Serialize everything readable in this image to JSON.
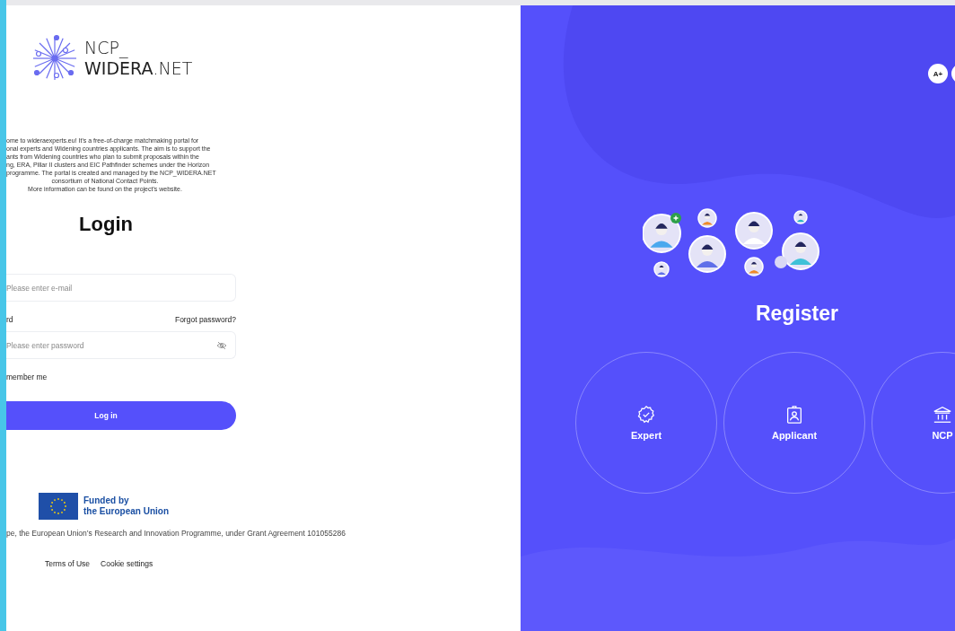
{
  "logo": {
    "line1": "NCP_",
    "line2": "**WIDERA**.NET"
  },
  "intro_lines": [
    "ome to wideraexperts.eu! It's a free-of-charge matchmaking portal for",
    "onal experts and Widening countries applicants. The aim is to support the",
    "ants from Widening countries who plan to submit proposals within the",
    "ng, ERA, Pillar II clusters and EIC Pathfinder schemes under the Horizon",
    "programme. The portal is created and managed by the NCP_WIDERA.NET",
    "consortium of National Contact Points.",
    "More information can be found on the project's website."
  ],
  "login": {
    "title": "Login",
    "email": {
      "placeholder": "Please enter e-mail"
    },
    "password_label": "rd",
    "forgot": "Forgot password?",
    "password": {
      "placeholder": "Please enter password"
    },
    "remember_label": "member me",
    "submit": "Log in"
  },
  "funding": {
    "label": "Funded by\nthe European Union"
  },
  "grant_text": "pe, the European Union’s Research and Innovation Programme, under Grant Agreement 101055286",
  "footer_links": [
    "Terms of Use",
    "Cookie settings"
  ],
  "font_size_button": "A+",
  "register": {
    "title": "Register",
    "options": [
      {
        "kind": "expert",
        "label": "Expert"
      },
      {
        "kind": "applicant",
        "label": "Applicant"
      },
      {
        "kind": "ncp",
        "label": "NCP"
      }
    ]
  }
}
